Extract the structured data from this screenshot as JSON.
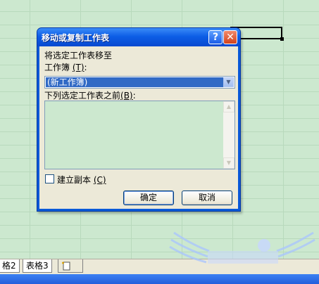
{
  "dialog": {
    "title": "移动或复制工作表",
    "help_glyph": "?",
    "close_glyph": "✕",
    "move_to_label": "将选定工作表移至",
    "workbook_label": "工作簿",
    "workbook_hotkey": "(T)",
    "workbook_label_suffix": ":",
    "workbook_value": "(新工作簿)",
    "before_sheet_label": "下列选定工作表之前",
    "before_sheet_hotkey": "(B)",
    "before_sheet_suffix": ":",
    "create_copy_label": "建立副本",
    "create_copy_hotkey": "(C)",
    "create_copy_checked": false,
    "ok_label": "确定",
    "cancel_label": "取消"
  },
  "sheet_tabs": [
    {
      "label": "格2"
    },
    {
      "label": "表格3"
    }
  ],
  "icons": {
    "combo_arrow": "chevron-down-icon",
    "scroll_up": "scroll-up-icon",
    "scroll_down": "scroll-down-icon",
    "new_sheet": "new-sheet-icon"
  },
  "colors": {
    "title_bar": "#0d5ee6",
    "selection": "#316ac5",
    "cell_background": "#cce8cf",
    "dialog_face": "#ece9d8"
  }
}
